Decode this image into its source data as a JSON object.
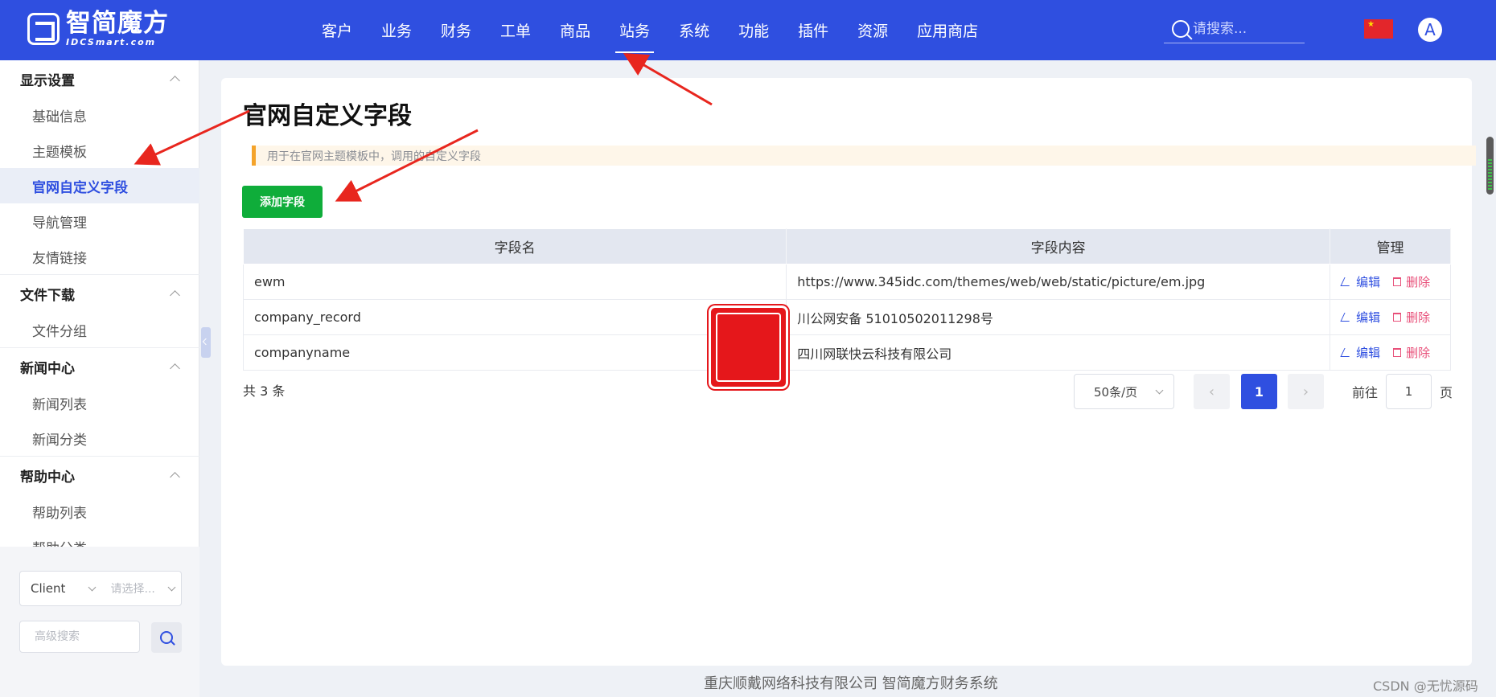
{
  "header": {
    "logo_cn": "智简魔方",
    "logo_en": "IDCSmart.com",
    "nav": [
      "客户",
      "业务",
      "财务",
      "工单",
      "商品",
      "站务",
      "系统",
      "功能",
      "插件",
      "资源",
      "应用商店"
    ],
    "nav_active": "站务",
    "search_placeholder": "请搜索...",
    "avatar_letter": "A"
  },
  "sidebar": {
    "groups": [
      {
        "title": "显示设置",
        "items": [
          "基础信息",
          "主题模板",
          "官网自定义字段",
          "导航管理",
          "友情链接"
        ]
      },
      {
        "title": "文件下载",
        "items": [
          "文件分组"
        ]
      },
      {
        "title": "新闻中心",
        "items": [
          "新闻列表",
          "新闻分类"
        ]
      },
      {
        "title": "帮助中心",
        "items": [
          "帮助列表",
          "帮助分类"
        ]
      }
    ],
    "active_item": "官网自定义字段",
    "select_client": "Client",
    "select_placeholder": "请选择...",
    "advanced_search_placeholder": "高级搜索"
  },
  "main": {
    "title": "官网自定义字段",
    "tip": "用于在官网主题模板中，调用的自定义字段",
    "add_button": "添加字段",
    "table": {
      "headers": [
        "字段名",
        "字段内容",
        "管理"
      ],
      "rows": [
        {
          "name": "ewm",
          "content": "https://www.345idc.com/themes/web/web/static/picture/em.jpg"
        },
        {
          "name": "company_record",
          "content": "川公网安备 51010502011298号"
        },
        {
          "name": "companyname",
          "content": "四川网联快云科技有限公司"
        }
      ],
      "edit_label": "编辑",
      "delete_label": "删除"
    },
    "pagination": {
      "total": "共 3 条",
      "page_size": "50条/页",
      "current_page": "1",
      "goto_prefix": "前往",
      "goto_value": "1",
      "goto_suffix": "页"
    }
  },
  "footer": "重庆顺戴网络科技有限公司 智简魔方财务系统",
  "credit": "CSDN @无忧源码",
  "colors": {
    "primary": "#2f4fe0",
    "add_button": "#0fad3a",
    "delete": "#e8507a",
    "arrow": "#e8261e"
  }
}
